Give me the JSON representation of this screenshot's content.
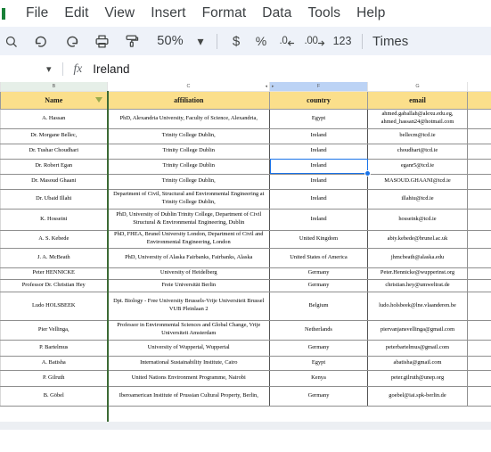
{
  "menu": {
    "accent_color": "#188038",
    "items": [
      "File",
      "Edit",
      "View",
      "Insert",
      "Format",
      "Data",
      "Tools",
      "Help"
    ]
  },
  "toolbar": {
    "search_icon": "search-icon",
    "undo_icon": "undo-icon",
    "redo_icon": "redo-icon",
    "print_icon": "print-icon",
    "paint_format_icon": "paint-format-icon",
    "zoom_level": "50%",
    "zoom_caret": "▾",
    "currency_label": "$",
    "percent_label": "%",
    "decrease_decimal_label": ".0",
    "increase_decimal_label": ".00",
    "number_format_label": "123",
    "font_name": "Times"
  },
  "formula_bar": {
    "name_box_caret": "▾",
    "fx_label": "fx",
    "value": "Ireland"
  },
  "grid": {
    "column_letters": [
      "B",
      "C",
      "F",
      "G"
    ],
    "selected_column": "F",
    "selected_cell_value": "Ireland",
    "headers": [
      "Name",
      "affiliation",
      "country",
      "email"
    ],
    "filter_on_column": "Name",
    "rows": [
      {
        "name": "A. Hassan",
        "affiliation": "PhD, Alexandria University, Faculty of Science, Alexandria,",
        "country": "Egypt",
        "email": "ahmed.gaballah@alexu.edu.eg, ahmed_hassan24@hotmail.com"
      },
      {
        "name": "Dr. Morgane Bellec,",
        "affiliation": "Trinity College Dublin,",
        "country": "Ireland",
        "email": "bellecm@tcd.ie"
      },
      {
        "name": "Dr. Tushar Choudhari",
        "affiliation": "Trinity College Dublin",
        "country": "Ireland",
        "email": "choudhart@tcd.ie"
      },
      {
        "name": "Dr. Robert Egan",
        "affiliation": "Trinity College Dublin",
        "country": "Ireland",
        "email": "eganr5@tcd.ie"
      },
      {
        "name": "Dr. Masoud Ghaani",
        "affiliation": "Trinity College Dublin,",
        "country": "Ireland",
        "email": "MASOUD.GHAANI@tcd.ie"
      },
      {
        "name": "Dr. Ubaid Illahi",
        "affiliation": "Department of Civil, Structural and Environmental Engineering at Trinity College Dublin,",
        "country": "Ireland",
        "email": "illahiu@tcd.ie"
      },
      {
        "name": "K. Hosseini",
        "affiliation": "PhD, University of Dublin Trinity College, Department of Civil Structural & Environmental Engineering, Dublin",
        "country": "Ireland",
        "email": "hosseink@tcd.ie"
      },
      {
        "name": "A. S. Kebede",
        "affiliation": "PhD, FHEA, Brunel University London, Department of Civil and Environmental Engineering, London",
        "country": "United Kingdom",
        "email": "abiy.kebede@brunel.ac.uk"
      },
      {
        "name": "J. A. McBeath",
        "affiliation": "PhD, University of Alaska Fairbanks, Fairbanks, Alaska",
        "country": "United States of America",
        "email": "jhmcbeath@alaska.edu"
      },
      {
        "name": "Peter HENNICKE",
        "affiliation": "University of Heidelberg",
        "country": "Germany",
        "email": "Peter.Hennicke@wupperinst.org"
      },
      {
        "name": "Professor Dr. Christian Hey",
        "affiliation": "Freie Universität Berlin",
        "country": "Germany",
        "email": "christian.hey@umweltrat.de"
      },
      {
        "name": "Ludo HOLSBEEK",
        "affiliation": "Dpt. Biology - Free University Brussels-Vrije Universiteit Brussel\nVUB Pleinlaan 2",
        "country": "Belgium",
        "email": "ludo.holsbeek@lne.vlaanderen.be"
      },
      {
        "name": "Pier Vellinga,",
        "affiliation": "Professor in Environmental Sciences and Global Change, Vrije Universiteit Amsterdam",
        "country": "Netherlands",
        "email": "piervanjansvellinga@gmail.com"
      },
      {
        "name": "P. Bartelmus",
        "affiliation": "University of Wuppertal, Wuppertal",
        "country": "Germany",
        "email": "peterbartelmus@gmail.com"
      },
      {
        "name": "A. Batisha",
        "affiliation": "International Sustainability Institute, Cairo",
        "country": "Egypt",
        "email": "abatisha@gmail.com"
      },
      {
        "name": "P. Gilruth",
        "affiliation": "United Nations Environment Programme, Nairobi",
        "country": "Kenya",
        "email": "peter.gilruth@unep.org"
      },
      {
        "name": "B. Göbel",
        "affiliation": "Iberoamerican Institute of Prussian Cultural Property, Berlin,",
        "country": "Germany",
        "email": "goebel@iai.spk-berlin.de"
      }
    ]
  }
}
